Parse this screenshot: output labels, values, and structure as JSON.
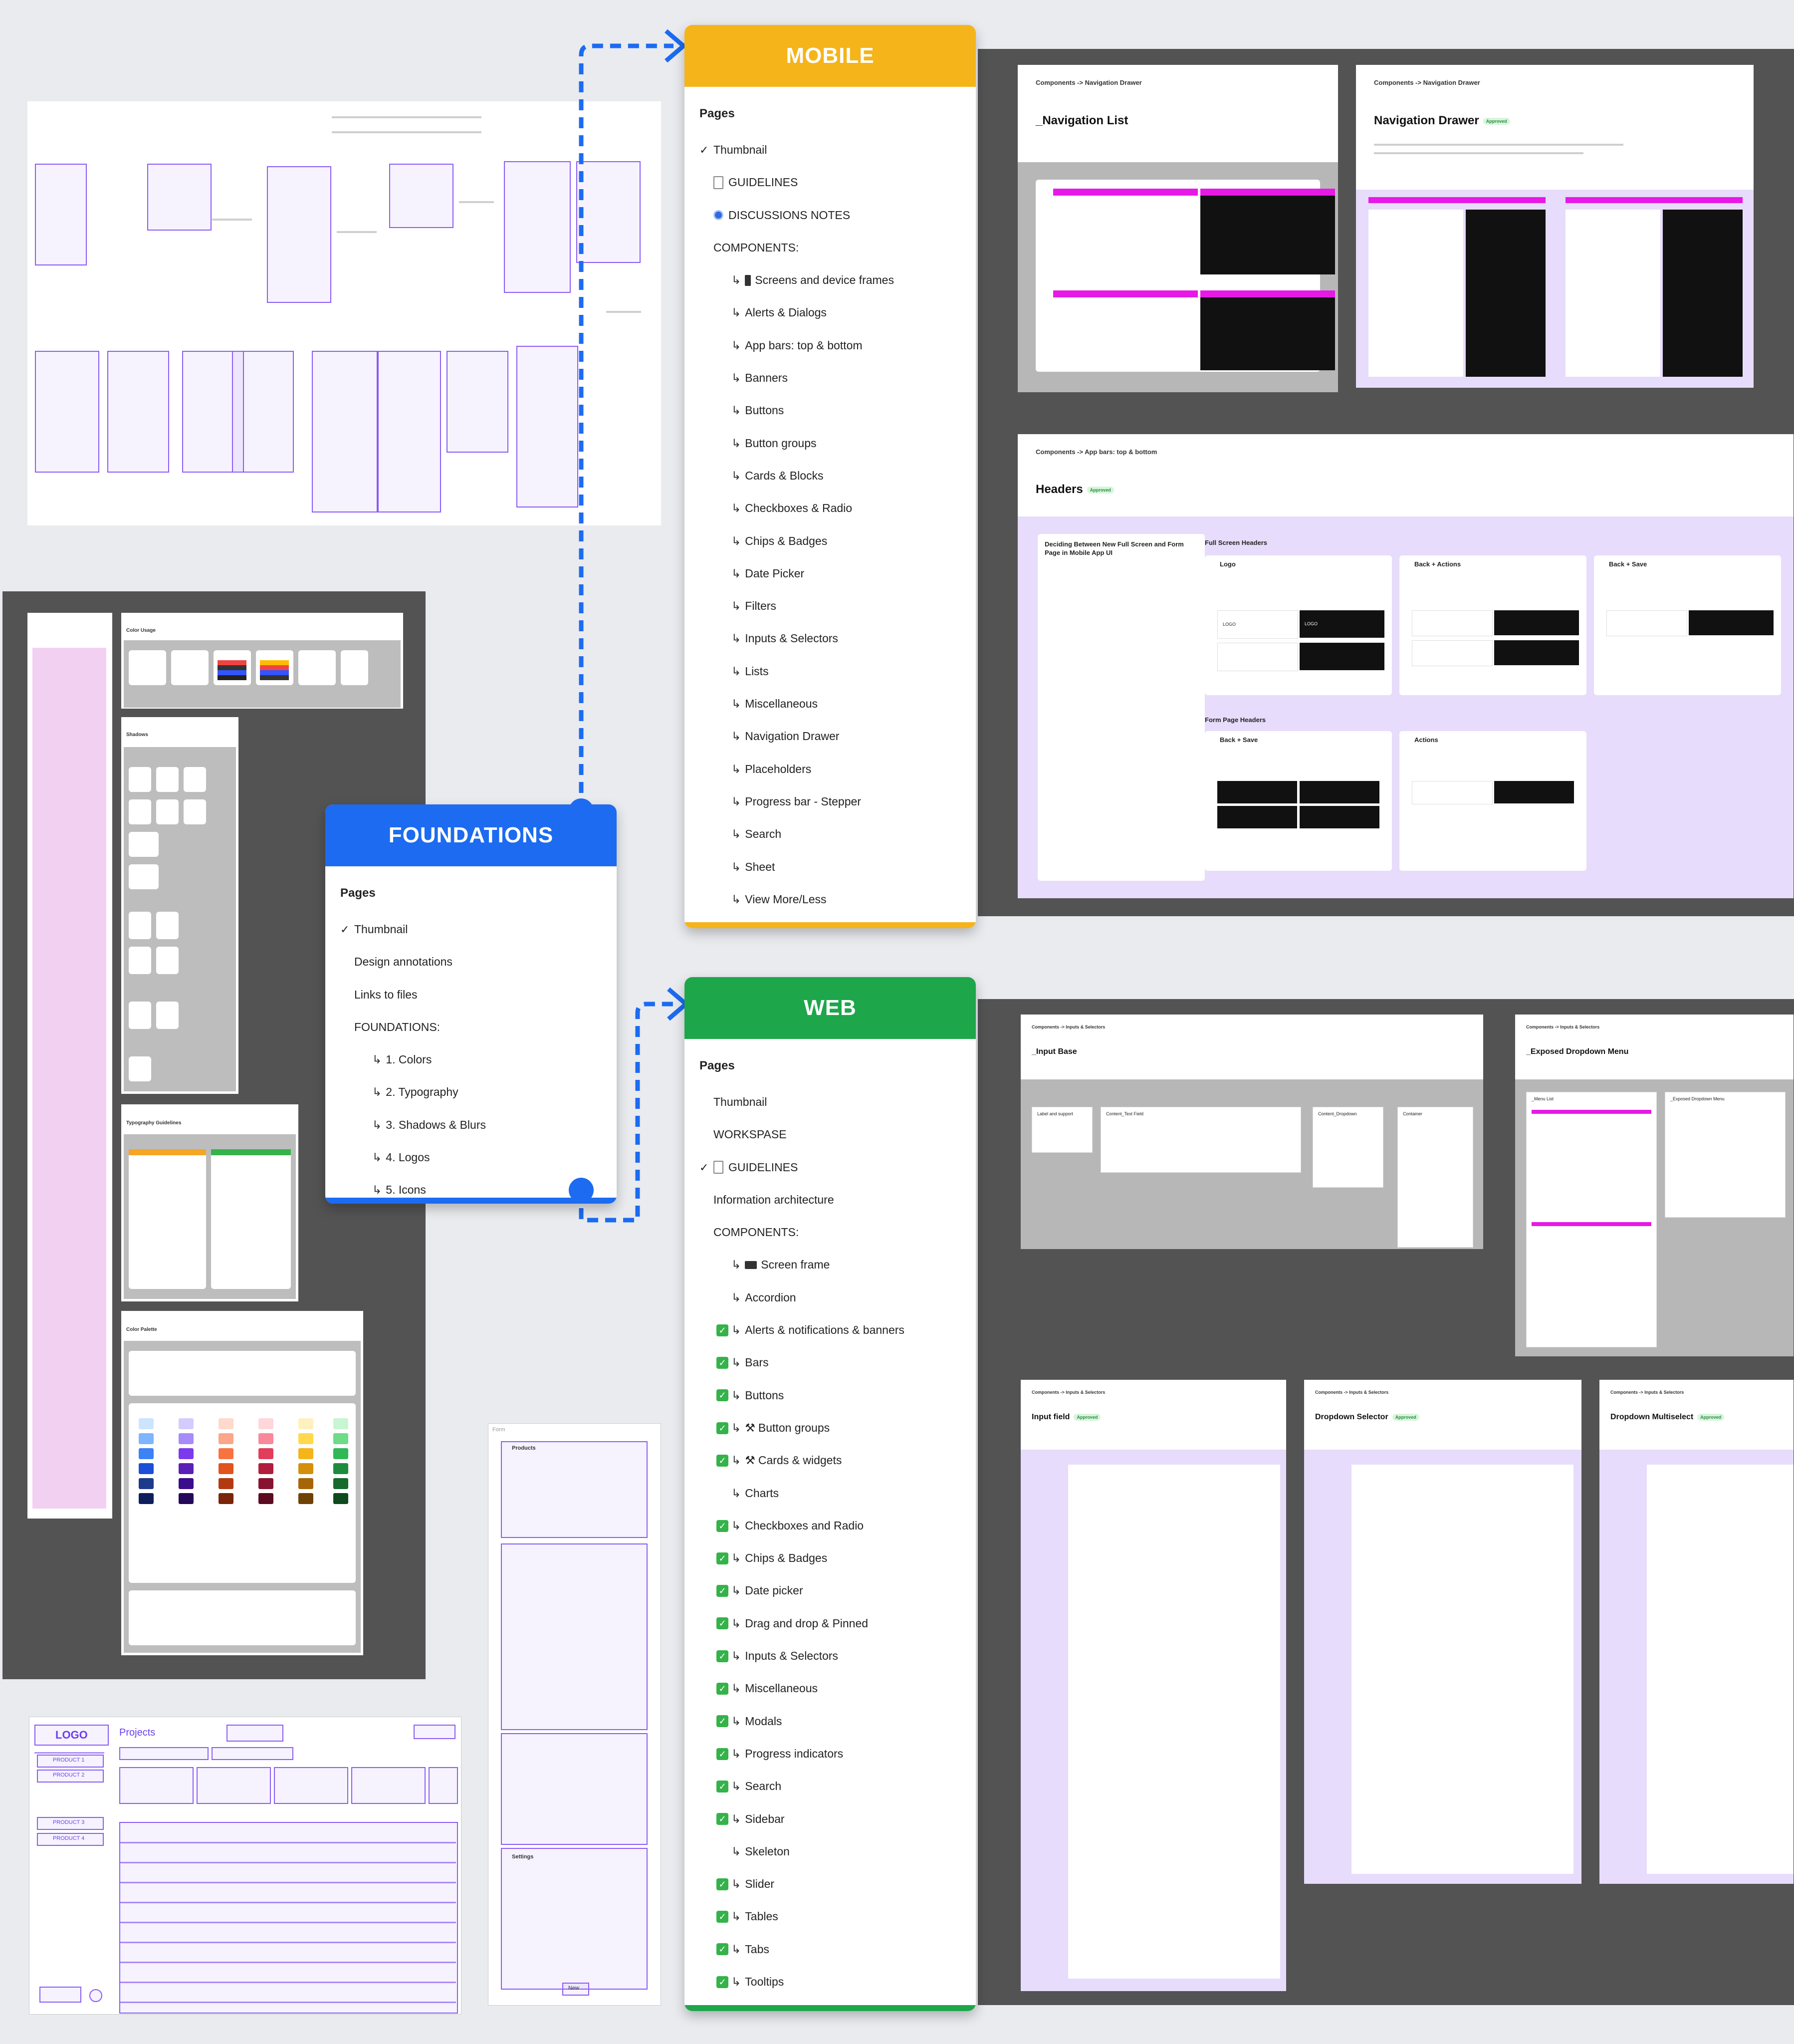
{
  "connectors_color": "#1c6bf1",
  "mobile": {
    "title": "MOBILE",
    "color": "#f5b419",
    "pages_label": "Pages",
    "items": [
      {
        "label": "Thumbnail",
        "checked": true
      },
      {
        "label": "GUIDELINES",
        "icon": "document-icon"
      },
      {
        "label": "DISCUSSIONS NOTES",
        "icon": "discussion-icon"
      },
      {
        "label": "COMPONENTS:"
      },
      {
        "label": "Screens and device frames",
        "icon": "phone-icon"
      },
      {
        "label": "Alerts & Dialogs"
      },
      {
        "label": "App bars: top & bottom"
      },
      {
        "label": "Banners"
      },
      {
        "label": "Buttons"
      },
      {
        "label": "Button groups"
      },
      {
        "label": "Cards & Blocks"
      },
      {
        "label": "Checkboxes & Radio"
      },
      {
        "label": "Chips & Badges"
      },
      {
        "label": "Date Picker"
      },
      {
        "label": "Filters"
      },
      {
        "label": "Inputs & Selectors"
      },
      {
        "label": "Lists"
      },
      {
        "label": "Miscellaneous"
      },
      {
        "label": "Navigation Drawer"
      },
      {
        "label": "Placeholders"
      },
      {
        "label": "Progress bar - Stepper"
      },
      {
        "label": "Search"
      },
      {
        "label": "Sheet"
      },
      {
        "label": "View More/Less"
      }
    ]
  },
  "foundations": {
    "title": "FOUNDATIONS",
    "color": "#1c6bf1",
    "pages_label": "Pages",
    "items": [
      {
        "label": "Thumbnail",
        "checked": true
      },
      {
        "label": "Design annotations"
      },
      {
        "label": "Links to files"
      },
      {
        "label": "FOUNDATIONS:"
      },
      {
        "label": "1. Colors"
      },
      {
        "label": "2. Typography"
      },
      {
        "label": "3. Shadows & Blurs"
      },
      {
        "label": "4. Logos"
      },
      {
        "label": "5. Icons"
      }
    ]
  },
  "web": {
    "title": "WEB",
    "color": "#1ea64a",
    "pages_label": "Pages",
    "items": [
      {
        "label": "Thumbnail"
      },
      {
        "label": "WORKSPASE"
      },
      {
        "label": "GUIDELINES",
        "checked": true,
        "icon": "document-icon"
      },
      {
        "label": "Information architecture"
      },
      {
        "label": "COMPONENTS:"
      },
      {
        "label": "Screen frame",
        "icon": "screen-icon"
      },
      {
        "label": "Accordion"
      },
      {
        "label": "Alerts & notifications & banners",
        "done": true
      },
      {
        "label": "Bars",
        "done": true
      },
      {
        "label": "Buttons",
        "done": true
      },
      {
        "label": "Button groups",
        "done": true,
        "tool": true
      },
      {
        "label": "Cards & widgets",
        "done": true,
        "tool": true
      },
      {
        "label": "Charts"
      },
      {
        "label": "Checkboxes and Radio",
        "done": true
      },
      {
        "label": "Chips & Badges",
        "done": true
      },
      {
        "label": "Date picker",
        "done": true
      },
      {
        "label": "Drag and drop & Pinned",
        "done": true
      },
      {
        "label": "Inputs & Selectors",
        "done": true
      },
      {
        "label": "Miscellaneous",
        "done": true
      },
      {
        "label": "Modals",
        "done": true
      },
      {
        "label": "Progress indicators",
        "done": true
      },
      {
        "label": "Search",
        "done": true
      },
      {
        "label": "Sidebar",
        "done": true
      },
      {
        "label": "Skeleton"
      },
      {
        "label": "Slider",
        "done": true
      },
      {
        "label": "Tables",
        "done": true
      },
      {
        "label": "Tabs",
        "done": true
      },
      {
        "label": "Tooltips",
        "done": true
      }
    ]
  },
  "mobile_frames": {
    "nav_list": {
      "breadcrumb": "Components -> Navigation Drawer",
      "title": "_Navigation List"
    },
    "nav_drawer": {
      "breadcrumb": "Components -> Navigation Drawer",
      "title": "Navigation Drawer",
      "tag": "Approved"
    },
    "headers": {
      "breadcrumb": "Components -> App bars: top & bottom",
      "title": "Headers",
      "tag": "Approved",
      "left_card_title": "Deciding Between New Full Screen and Form Page in Mobile App UI",
      "full_screen_label": "Full Screen Headers",
      "form_page_label": "Form Page Headers",
      "logo_label": "Logo",
      "back_actions_label": "Back + Actions",
      "back_save_label": "Back + Save",
      "form_back_save_label": "Back + Save",
      "form_actions_label": "Actions",
      "logo_text": "LOGO"
    }
  },
  "web_frames": {
    "input_base": {
      "breadcrumb": "Components -> Inputs & Selectors",
      "title": "_Input Base",
      "cols": [
        "Label and support",
        "Content_Text Field",
        "Content_Dropdown",
        "Container"
      ]
    },
    "exposed_dropdown": {
      "breadcrumb": "Components -> Inputs & Selectors",
      "title": "_Exposed Dropdown Menu",
      "cols": [
        "_Menu List",
        "_Exposed Dropdown Menu"
      ]
    },
    "input_field": {
      "breadcrumb": "Components -> Inputs & Selectors",
      "title": "Input field",
      "tag": "Approved"
    },
    "dropdown_selector": {
      "breadcrumb": "Components -> Inputs & Selectors",
      "title": "Dropdown Selector",
      "tag": "Approved"
    },
    "dropdown_multiselect": {
      "breadcrumb": "Components -> Inputs & Selectors",
      "title": "Dropdown Multiselect",
      "tag": "Approved"
    }
  },
  "foundation_frames": {
    "color_usage": "Color Usage",
    "shadows": "Shadows",
    "typography_guidelines": "Typography Guidelines",
    "color_palette": "Color Palette"
  },
  "wireframe": {
    "logo": "LOGO",
    "projects": "Projects",
    "products": [
      "PRODUCT 1",
      "PRODUCT 2",
      "PRODUCT 3",
      "PRODUCT 4"
    ],
    "form_label": "Form",
    "form_products": "Products",
    "form_settings": "Settings",
    "new_button": "New"
  }
}
